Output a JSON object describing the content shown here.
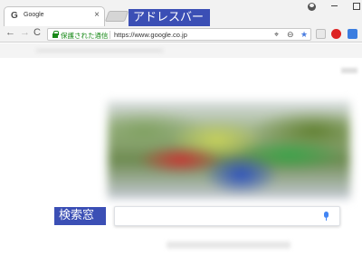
{
  "tab": {
    "favicon": "G",
    "title": "Google",
    "close": "×"
  },
  "annotations": {
    "address_bar": "アドレスバー",
    "search_box": "検索窓"
  },
  "toolbar": {
    "back": "←",
    "forward": "→",
    "reload": "C"
  },
  "omnibox": {
    "security_text": "保護された通信",
    "url": "https://www.google.co.jp"
  },
  "icons": {
    "favicon": "google-g-icon",
    "close": "close-icon",
    "profile": "profile-icon",
    "lock": "lock-icon",
    "target": "location-target-icon",
    "zoom": "zoom-icon",
    "star": "bookmark-star-icon",
    "mic": "microphone-icon"
  },
  "colors": {
    "annotation_bg": "#3b4fb5",
    "secure_green": "#1a8a1a",
    "star_blue": "#4a7de0",
    "mic_blue": "#4285f4"
  }
}
